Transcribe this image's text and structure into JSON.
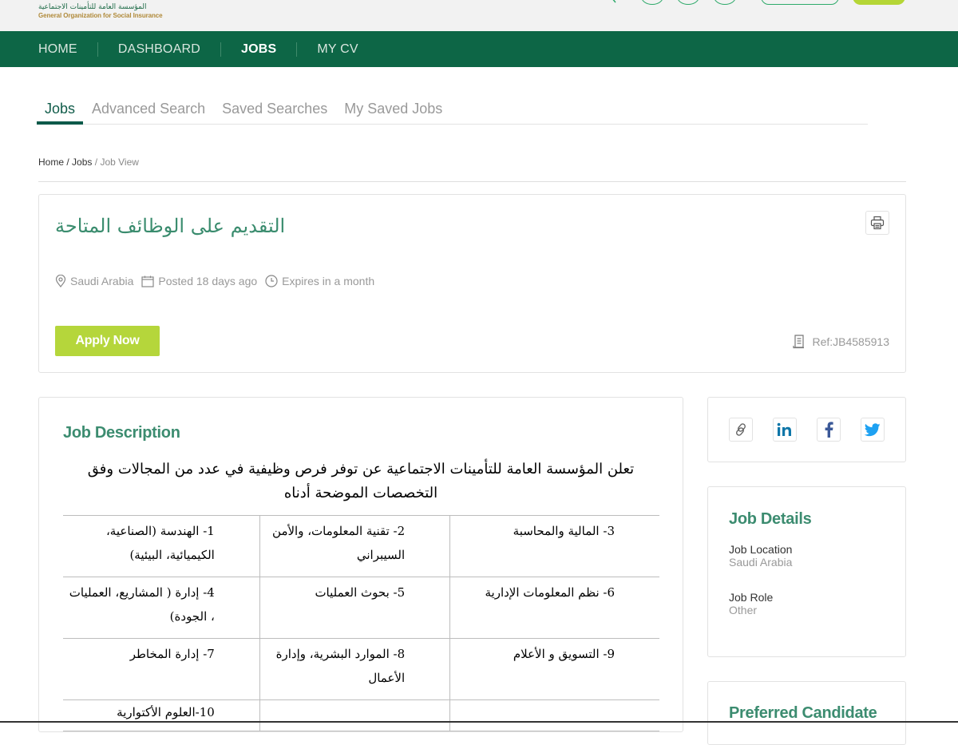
{
  "header": {
    "logo_ar": "المؤسسة العامة للتأمينات الاجتماعية",
    "logo_en": "General Organization for Social Insurance"
  },
  "nav": {
    "items": [
      {
        "label": "HOME",
        "active": false
      },
      {
        "label": "DASHBOARD",
        "active": false
      },
      {
        "label": "JOBS",
        "active": true
      },
      {
        "label": "MY CV",
        "active": false
      }
    ]
  },
  "tabs": [
    {
      "label": "Jobs",
      "active": true
    },
    {
      "label": "Advanced Search",
      "active": false
    },
    {
      "label": "Saved Searches",
      "active": false
    },
    {
      "label": "My Saved Jobs",
      "active": false
    }
  ],
  "breadcrumb": {
    "home": "Home",
    "jobs": "Jobs",
    "current": "Job View",
    "sep": "/"
  },
  "job": {
    "title": "التقديم على الوظائف المتاحة",
    "location": "Saudi Arabia",
    "posted": "Posted 18 days ago",
    "expires": "Expires in a month",
    "apply_label": "Apply Now",
    "ref": "Ref:JB4585913"
  },
  "description": {
    "heading": "Job Description",
    "intro": "تعلن المؤسسة العامة للتأمينات الاجتماعية عن توفر فرص وظيفية في عدد من المجالات وفق التخصصات الموضحة أدناه",
    "table": [
      [
        "1-   الهندسة (الصناعية، الكيميائية، البيئية)",
        "2-   تقنية المعلومات، والأمن السيبراني",
        "3-   المالية والمحاسبة"
      ],
      [
        "4-   إدارة ( المشاريع، العمليات ، الجودة)",
        "5-   بحوث العمليات",
        "6-   نظم المعلومات الإدارية"
      ],
      [
        "7-   إدارة المخاطر",
        "8-   الموارد البشرية، وإدارة الأعمال",
        "9-   التسويق و الأعلام"
      ],
      [
        "10-العلوم الأكتوارية",
        "",
        ""
      ]
    ]
  },
  "share": {
    "items": [
      "copy-link",
      "linkedin",
      "facebook",
      "twitter"
    ]
  },
  "details": {
    "heading": "Job Details",
    "fields": [
      {
        "label": "Job Location",
        "value": "Saudi Arabia"
      },
      {
        "label": "Job Role",
        "value": "Other"
      }
    ]
  },
  "preferred": {
    "heading": "Preferred Candidate"
  },
  "colors": {
    "brand_green": "#0d6646",
    "accent_lime": "#b5d63b",
    "heading_green": "#3c8c70"
  }
}
